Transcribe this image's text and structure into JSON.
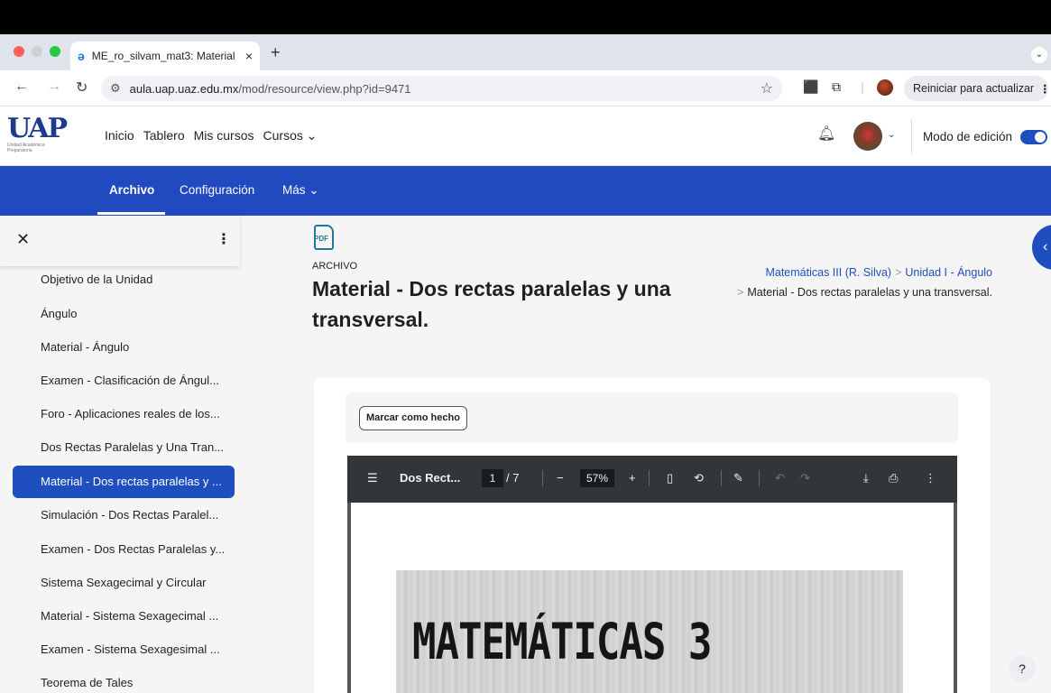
{
  "browser": {
    "tab_title": "ME_ro_silvam_mat3: Material",
    "tab_close": "×",
    "new_tab": "+",
    "tab_menu": "⌄",
    "url_host": "aula.uap.uaz.edu.mx",
    "url_path": "/mod/resource/view.php?id=9471",
    "restart_label": "Reiniciar para actualizar",
    "restart_menu": "⋮"
  },
  "site": {
    "logo_text": "UAP",
    "logo_tagline": "Unidad Académica Preparatoria",
    "nav": [
      "Inicio",
      "Tablero",
      "Mis cursos",
      "Cursos ⌄"
    ],
    "edit_mode_label": "Modo de edición"
  },
  "secondary_nav": {
    "active": "Archivo",
    "config": "Configuración",
    "more": "Más ⌄"
  },
  "drawer": {
    "items": [
      "Objetivo de la Unidad",
      "Ángulo",
      "Material - Ángulo",
      "Examen - Clasificación de Ángul...",
      "Foro - Aplicaciones reales de los...",
      "Dos Rectas Paralelas y Una Tran...",
      "Material - Dos rectas paralelas y ...",
      "Simulación - Dos Rectas Paralel...",
      "Examen - Dos Rectas Paralelas y...",
      "Sistema Sexagecimal y Circular",
      "Material - Sistema Sexagecimal ...",
      "Examen - Sistema Sexagesimal ...",
      "Teorema de Tales"
    ],
    "selected_index": 6
  },
  "page": {
    "icon_label": "PDF",
    "kind": "ARCHIVO",
    "title": "Material - Dos rectas paralelas y una transversal.",
    "breadcrumb": {
      "course": "Matemáticas III (R. Silva)",
      "unit": "Unidad I - Ángulo",
      "current": "Material - Dos rectas paralelas y una transversal."
    },
    "mark_done": "Marcar como hecho"
  },
  "pdf": {
    "doc_name": "Dos Rect...",
    "page_current": "1",
    "page_total": "/ 7",
    "zoom": "57%",
    "cover_title": "MATEMÁTICAS 3"
  },
  "help": "?"
}
